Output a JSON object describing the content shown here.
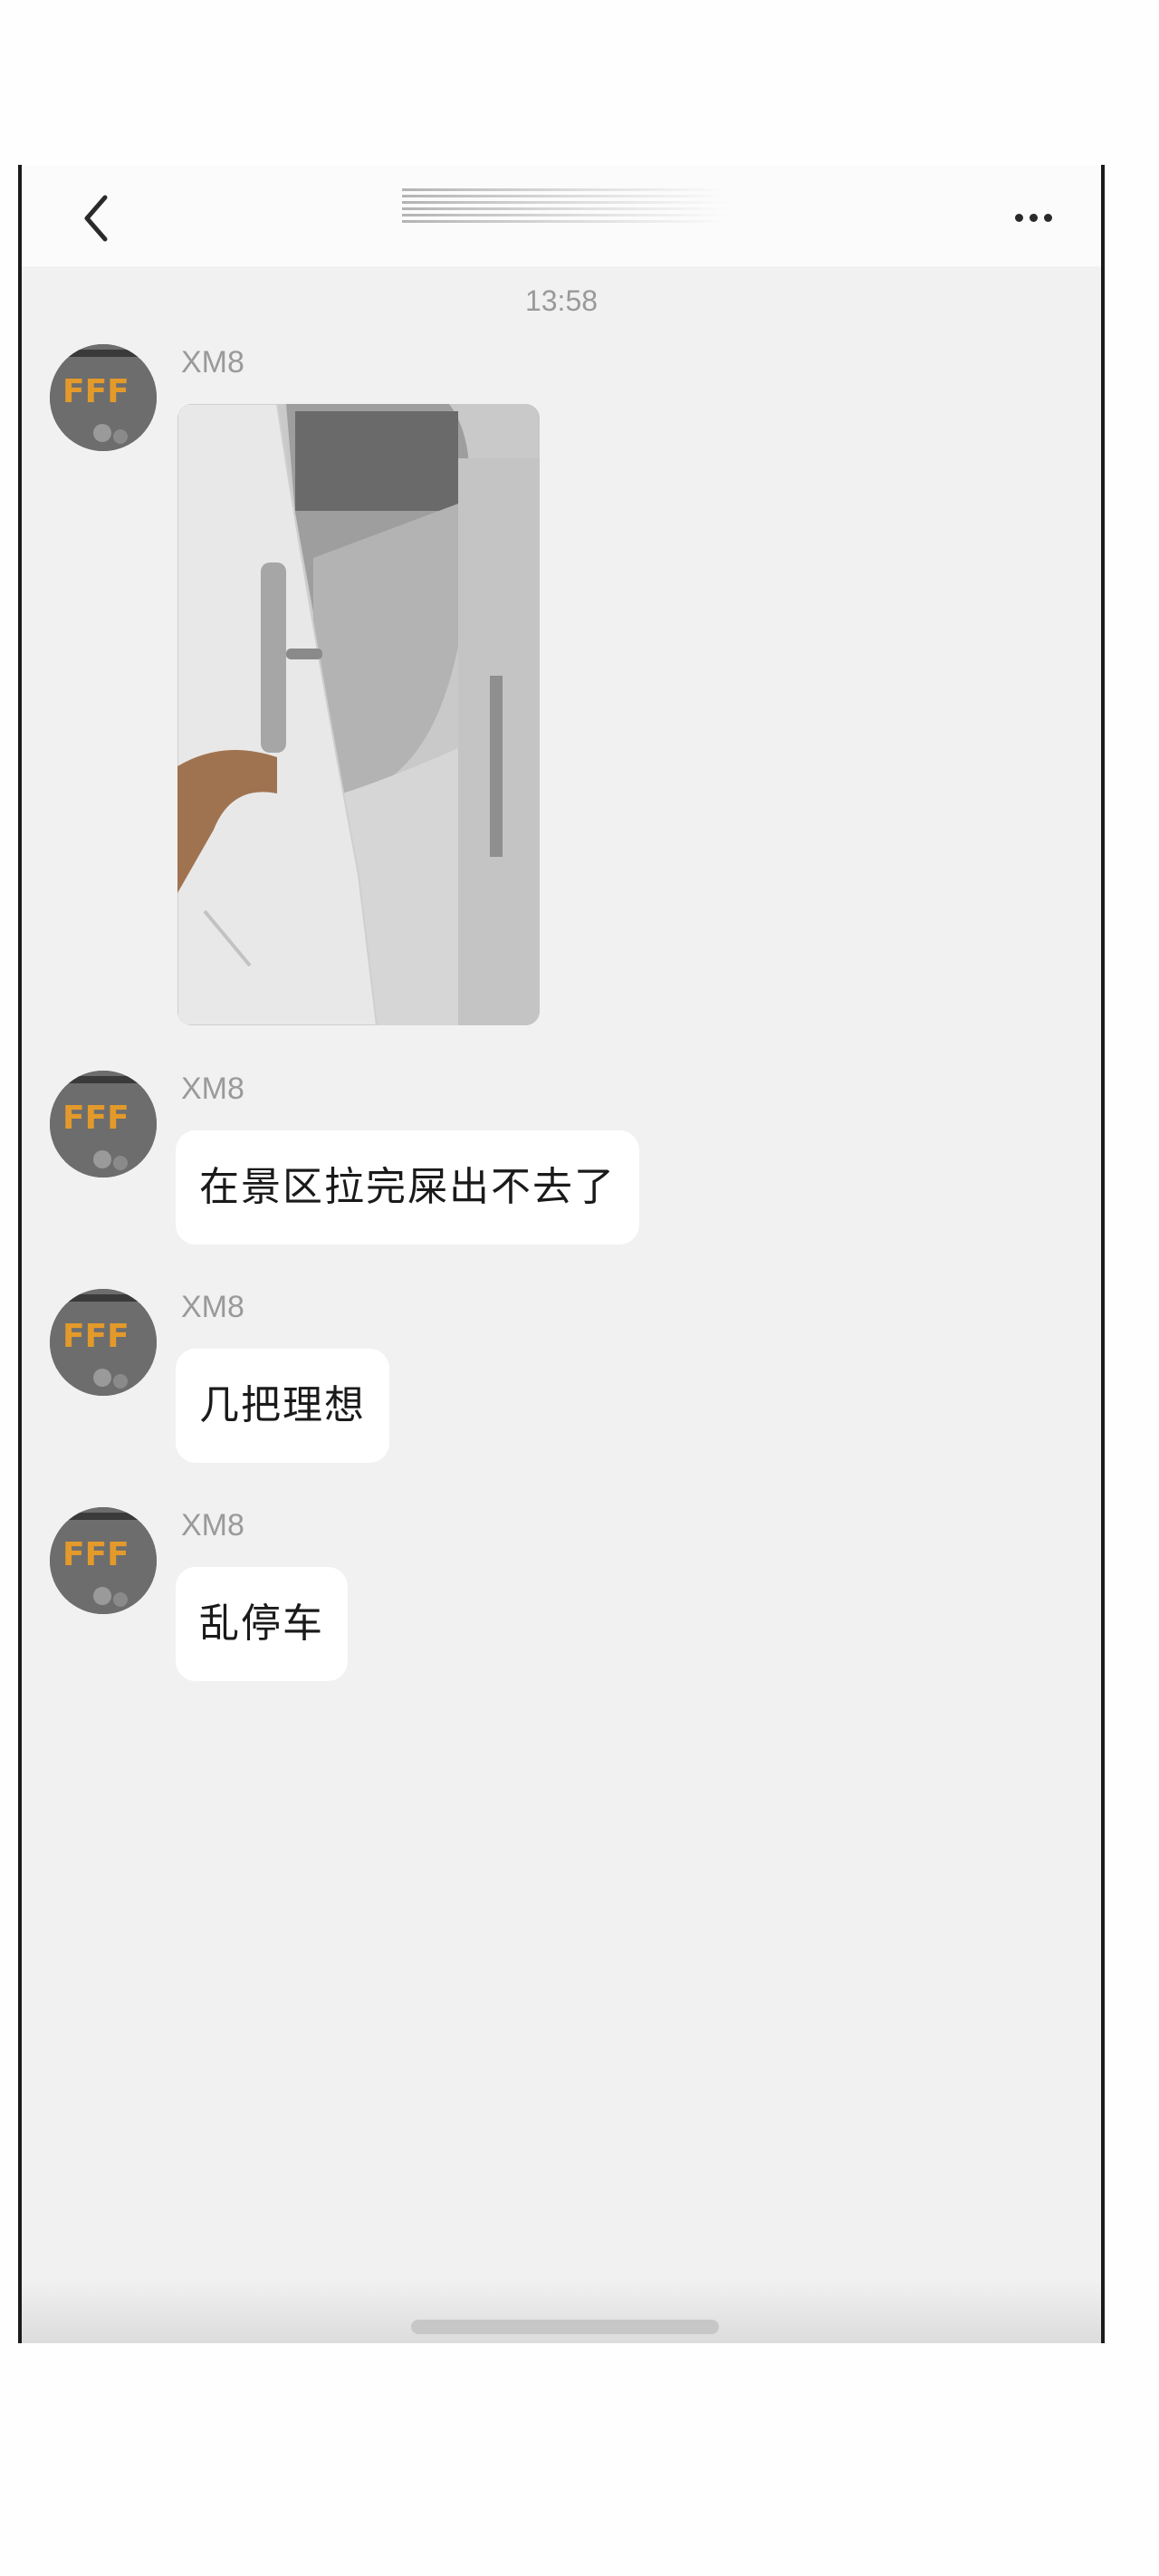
{
  "header": {
    "back_icon": "chevron-left-icon",
    "more_icon": "more-horizontal-icon"
  },
  "chat": {
    "timestamp": "13:58",
    "messages": [
      {
        "sender": "XM8",
        "type": "image"
      },
      {
        "sender": "XM8",
        "type": "text",
        "text": "在景区拉完屎出不去了"
      },
      {
        "sender": "XM8",
        "type": "text",
        "text": "几把理想"
      },
      {
        "sender": "XM8",
        "type": "text",
        "text": "乱停车"
      }
    ]
  },
  "colors": {
    "chat_background": "#f1f1f1",
    "bubble": "#ffffff",
    "meta_text": "#9a9a9a",
    "frame": "#1b1b1b"
  }
}
